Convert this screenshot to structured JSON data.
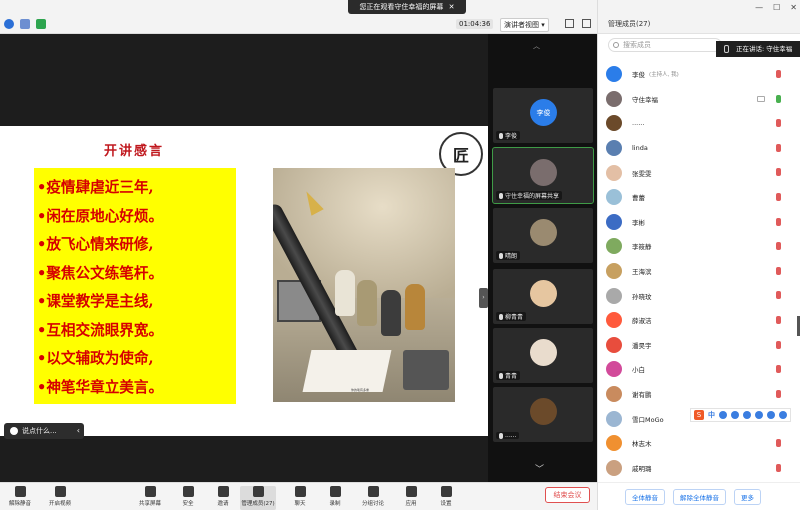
{
  "topbar": {
    "share_banner": "您正在观看守住幸福的屏幕",
    "timer": "01:04:36",
    "view_mode": "演讲者视图"
  },
  "slide": {
    "title": "开讲感言",
    "poem_lines": [
      "•疫情肆虐近三年,",
      "•闲在原地心好烦。",
      "•放飞心情来研修,",
      "•聚焦公文练笔杆。",
      "•课堂教学是主线,",
      "•互相交流眼界宽。",
      "•以文辅政为使命,",
      "•神笔华章立美言。"
    ],
    "photo_caption": "你的笔有多重"
  },
  "chat_bubble": {
    "text": "说点什么..."
  },
  "strip": {
    "tiles": [
      {
        "name": "李俊",
        "avatar_text": "李俊",
        "color": "#2b7de9"
      },
      {
        "name": "守住幸福的屏幕共享",
        "avatar_text": "",
        "color": "#7a6d6d"
      },
      {
        "name": "晴朗",
        "avatar_text": "",
        "color": "#9a8a70"
      },
      {
        "name": "柳青青",
        "avatar_text": "",
        "color": "#e6c6a0"
      },
      {
        "name": "青青",
        "avatar_text": "",
        "color": "#e9dccd"
      },
      {
        "name": "......",
        "avatar_text": "",
        "color": "#6b4a2a"
      }
    ]
  },
  "panel": {
    "title": "管理成员(27)",
    "search_placeholder": "搜索成员",
    "speaking": "正在讲话: 守住幸福",
    "participants": [
      {
        "name": "李俊",
        "sub": "(主持人, 我)",
        "color": "#2b7de9",
        "mic_on": false
      },
      {
        "name": "守住幸福",
        "sub": "",
        "color": "#7a6d6d",
        "mic_on": true
      },
      {
        "name": "......",
        "sub": "",
        "color": "#6b4a2a",
        "mic_on": false
      },
      {
        "name": "linda",
        "sub": "",
        "color": "#5a7fb0",
        "mic_on": false
      },
      {
        "name": "张雯雯",
        "sub": "",
        "color": "#e3bfa5",
        "mic_on": false
      },
      {
        "name": "曹蕾",
        "sub": "",
        "color": "#9ac0d8",
        "mic_on": false
      },
      {
        "name": "李彬",
        "sub": "",
        "color": "#3c6cc4",
        "mic_on": false
      },
      {
        "name": "李筱静",
        "sub": "",
        "color": "#7faa5f",
        "mic_on": false
      },
      {
        "name": "王海滨",
        "sub": "",
        "color": "#c7a060",
        "mic_on": false
      },
      {
        "name": "孙晓玟",
        "sub": "",
        "color": "#a9a9a9",
        "mic_on": false
      },
      {
        "name": "薛淑洁",
        "sub": "",
        "color": "#ff5a3c",
        "mic_on": false
      },
      {
        "name": "潘昊宇",
        "sub": "",
        "color": "#e84d3d",
        "mic_on": false
      },
      {
        "name": "小白",
        "sub": "",
        "color": "#d24a9a",
        "mic_on": false
      },
      {
        "name": "谢有鹏",
        "sub": "",
        "color": "#c98b5e",
        "mic_on": false
      },
      {
        "name": "雪口MoGo",
        "sub": "",
        "color": "#9bb6d2",
        "mic_on": false
      },
      {
        "name": "林志木",
        "sub": "",
        "color": "#f09030",
        "mic_on": false
      },
      {
        "name": "戚明璐",
        "sub": "",
        "color": "#caa080",
        "mic_on": false
      }
    ],
    "footer_buttons": [
      "全体静音",
      "解除全体静音",
      "更多"
    ]
  },
  "sogou": {
    "label": "中"
  },
  "bottombar": {
    "buttons": [
      "解除静音",
      "开启视频",
      "共享屏幕",
      "安全",
      "邀请",
      "管理成员(27)",
      "聊天",
      "录制",
      "分组讨论",
      "应用",
      "设置"
    ],
    "leave": "结束会议"
  }
}
